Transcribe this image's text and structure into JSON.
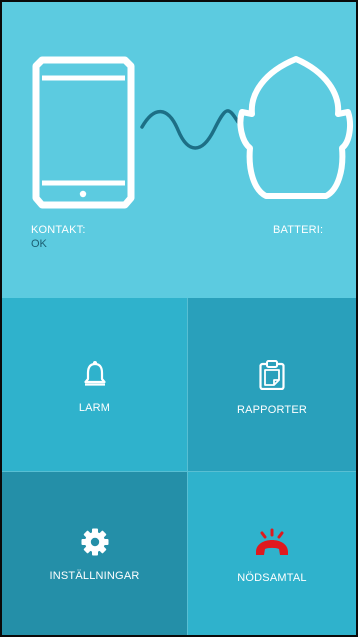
{
  "status": {
    "contact_label": "KONTAKT:",
    "contact_value": "OK",
    "battery_label": "BATTERI:",
    "battery_value": ""
  },
  "tiles": [
    {
      "label": "LARM",
      "icon": "bell-icon"
    },
    {
      "label": "RAPPORTER",
      "icon": "clipboard-icon"
    },
    {
      "label": "INSTÄLLNINGAR",
      "icon": "gear-icon"
    },
    {
      "label": "NÖDSAMTAL",
      "icon": "emergency-call-icon"
    }
  ],
  "colors": {
    "status_panel": "#5ccbe0",
    "alarm_tile": "#2fb2cc",
    "reports_tile": "#29a0bb",
    "settings_tile": "#248fa8",
    "emergency_tile": "#2fb2cc",
    "connection_wave": "#1d6f86",
    "emergency_icon": "#e0191e"
  }
}
